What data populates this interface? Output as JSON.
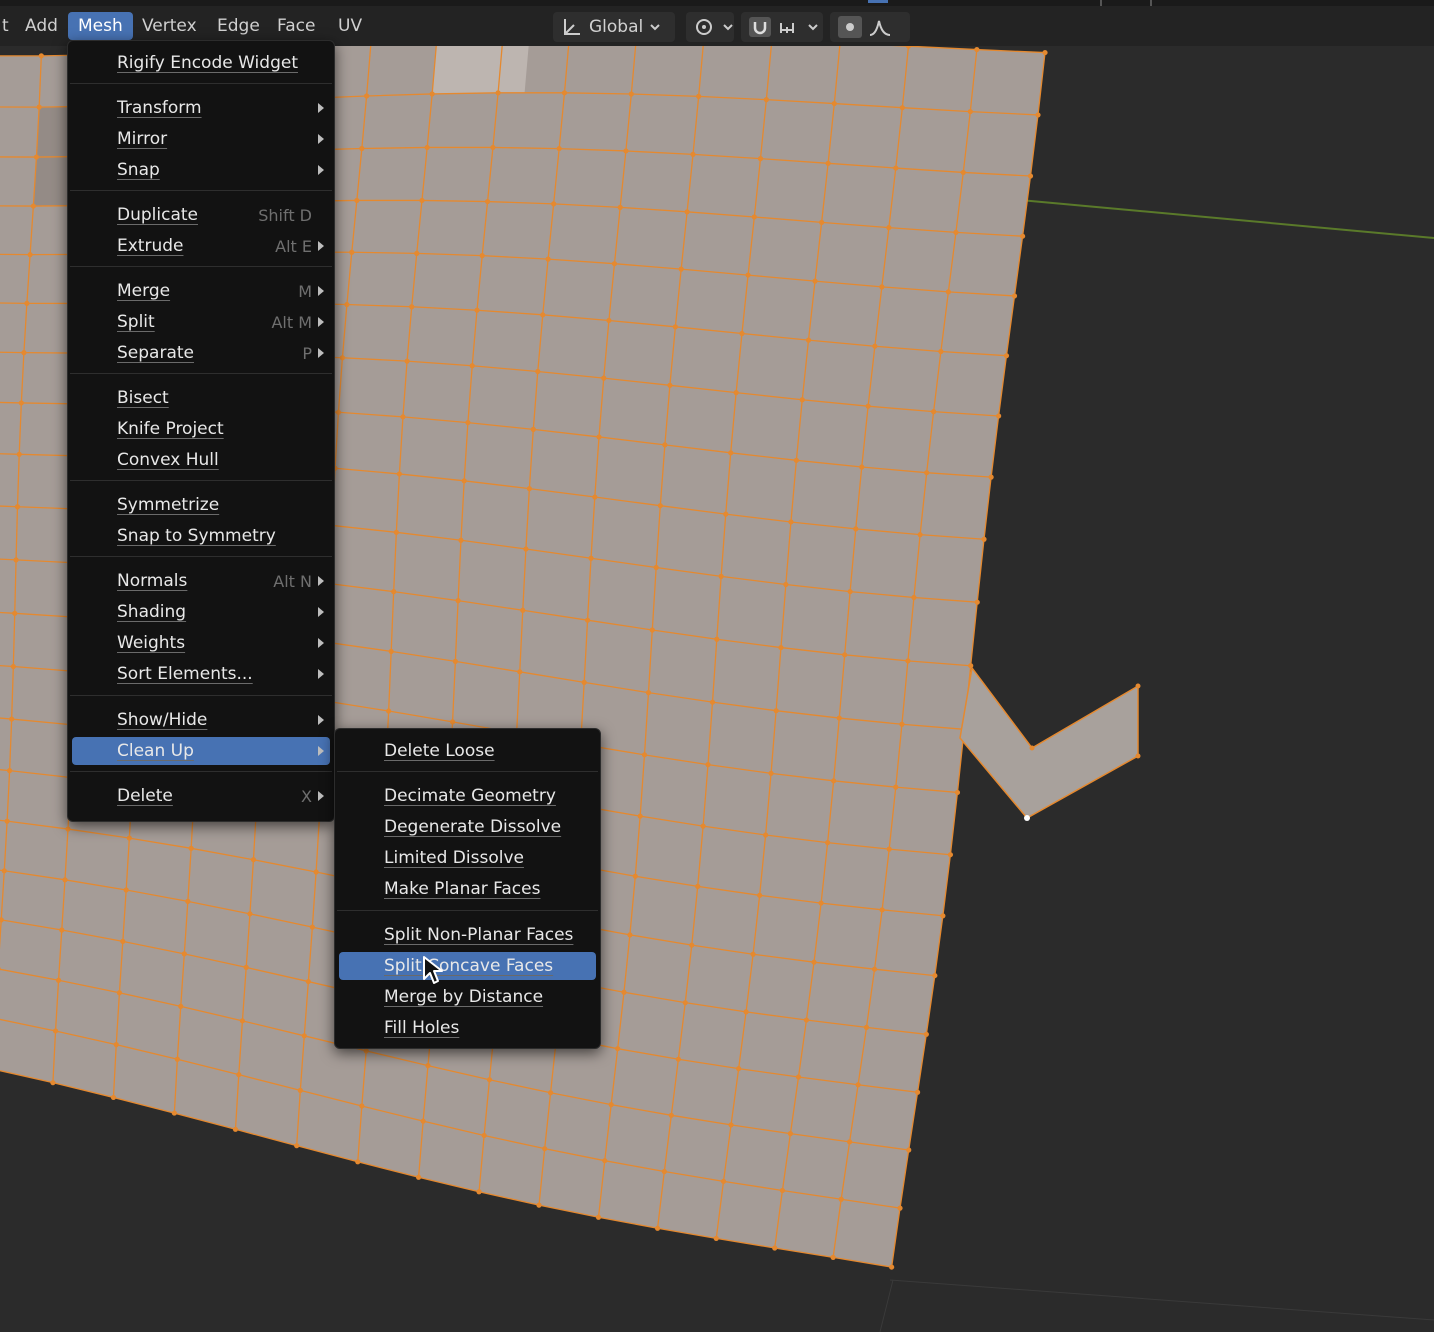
{
  "header": {
    "menus": [
      {
        "label": "t"
      },
      {
        "label": "Add"
      },
      {
        "label": "Mesh"
      },
      {
        "label": "Vertex"
      },
      {
        "label": "Edge"
      },
      {
        "label": "Face"
      },
      {
        "label": "UV"
      }
    ],
    "transform_orientation": "Global"
  },
  "mesh_menu": {
    "items": [
      {
        "label": "Rigify Encode Widget",
        "shortcut": "",
        "submenu": false
      },
      {
        "label": "Transform",
        "shortcut": "",
        "submenu": true
      },
      {
        "label": "Mirror",
        "shortcut": "",
        "submenu": true
      },
      {
        "label": "Snap",
        "shortcut": "",
        "submenu": true
      },
      {
        "label": "Duplicate",
        "shortcut": "Shift D",
        "submenu": false
      },
      {
        "label": "Extrude",
        "shortcut": "Alt E",
        "submenu": true
      },
      {
        "label": "Merge",
        "shortcut": "M",
        "submenu": true
      },
      {
        "label": "Split",
        "shortcut": "Alt M",
        "submenu": true
      },
      {
        "label": "Separate",
        "shortcut": "P",
        "submenu": true
      },
      {
        "label": "Bisect",
        "shortcut": "",
        "submenu": false
      },
      {
        "label": "Knife Project",
        "shortcut": "",
        "submenu": false
      },
      {
        "label": "Convex Hull",
        "shortcut": "",
        "submenu": false
      },
      {
        "label": "Symmetrize",
        "shortcut": "",
        "submenu": false
      },
      {
        "label": "Snap to Symmetry",
        "shortcut": "",
        "submenu": false
      },
      {
        "label": "Normals",
        "shortcut": "Alt N",
        "submenu": true
      },
      {
        "label": "Shading",
        "shortcut": "",
        "submenu": true
      },
      {
        "label": "Weights",
        "shortcut": "",
        "submenu": true
      },
      {
        "label": "Sort Elements...",
        "shortcut": "",
        "submenu": true
      },
      {
        "label": "Show/Hide",
        "shortcut": "",
        "submenu": true
      },
      {
        "label": "Clean Up",
        "shortcut": "",
        "submenu": true,
        "highlighted": true
      },
      {
        "label": "Delete",
        "shortcut": "X",
        "submenu": true
      }
    ]
  },
  "cleanup_menu": {
    "items": [
      {
        "label": "Delete Loose"
      },
      {
        "label": "Decimate Geometry"
      },
      {
        "label": "Degenerate Dissolve"
      },
      {
        "label": "Limited Dissolve"
      },
      {
        "label": "Make Planar Faces"
      },
      {
        "label": "Split Non-Planar Faces"
      },
      {
        "label": "Split Concave Faces",
        "highlighted": true
      },
      {
        "label": "Merge by Distance"
      },
      {
        "label": "Fill Holes"
      }
    ]
  },
  "colors": {
    "background": "#2b2b2b",
    "mesh_face": "#a59c97",
    "mesh_edge": "#e5892f",
    "menu_bg": "#121212",
    "highlight": "#4772b3"
  }
}
